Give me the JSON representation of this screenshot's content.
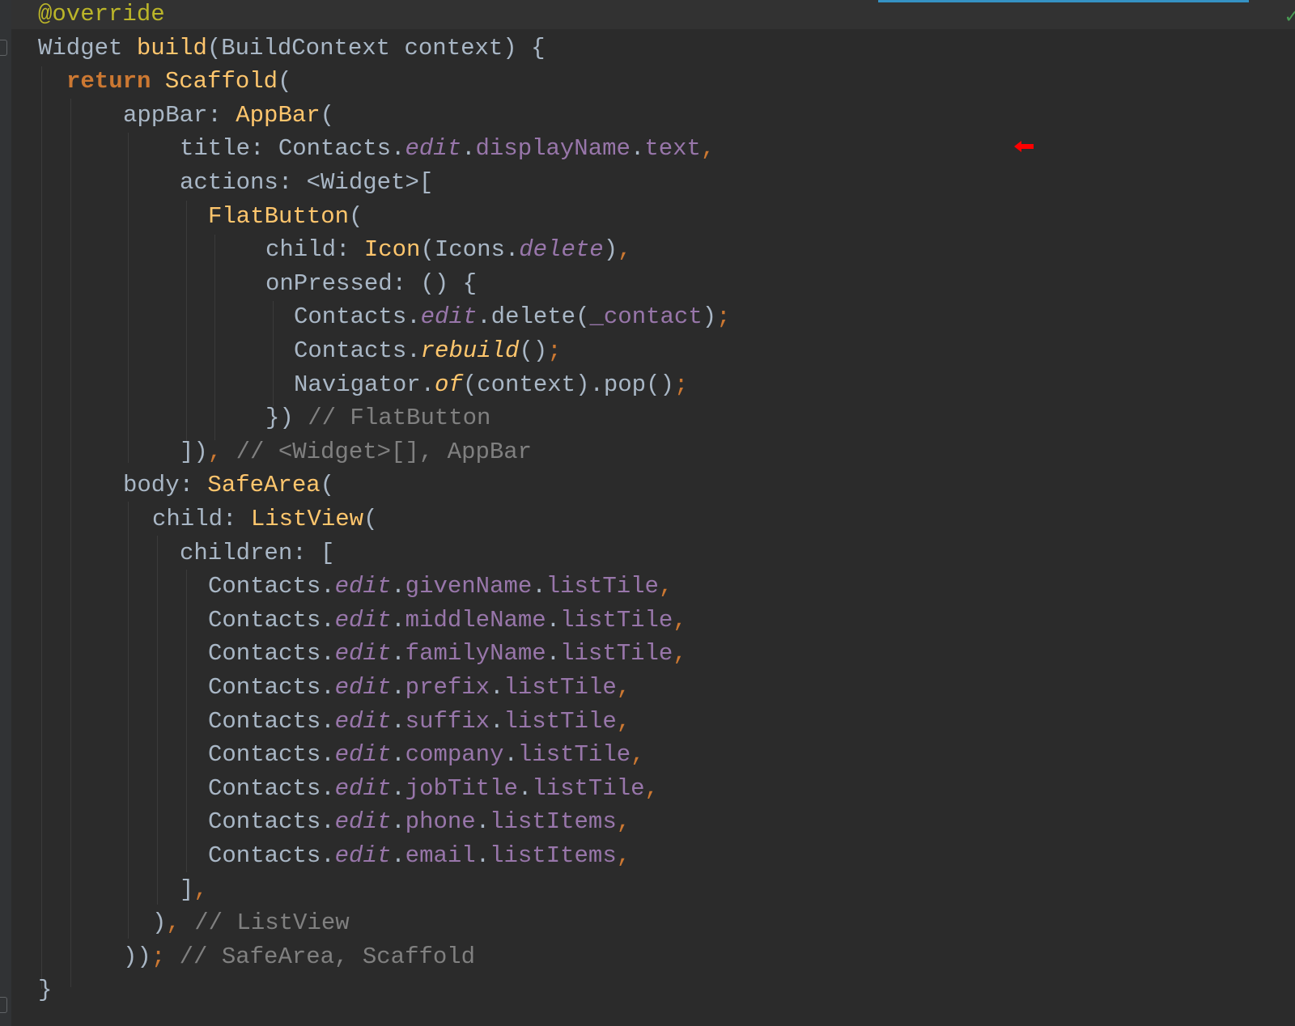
{
  "editor": {
    "theme_colors": {
      "background": "#2b2b2b",
      "default": "#a9b7c6",
      "keyword": "#cc7832",
      "class": "#ffc66d",
      "field": "#9876aa",
      "comment": "#808080",
      "annotation": "#bbb529",
      "marker": "#ff0000"
    },
    "marker_icon": "red-arrow-left-icon",
    "status_icon": "check-icon",
    "lines": [
      [
        {
          "t": "@override",
          "c": "ann"
        }
      ],
      [
        {
          "t": "Widget ",
          "c": ""
        },
        {
          "t": "build",
          "c": "cls"
        },
        {
          "t": "(BuildContext context) {",
          "c": ""
        }
      ],
      [
        {
          "t": "return ",
          "c": "kw"
        },
        {
          "t": "Scaffold",
          "c": "cls"
        },
        {
          "t": "(",
          "c": ""
        }
      ],
      [
        {
          "t": "appBar: ",
          "c": ""
        },
        {
          "t": "AppBar",
          "c": "cls"
        },
        {
          "t": "(",
          "c": ""
        }
      ],
      [
        {
          "t": "title: Contacts.",
          "c": ""
        },
        {
          "t": "edit",
          "c": "ital"
        },
        {
          "t": ".",
          "c": ""
        },
        {
          "t": "displayName",
          "c": "fld"
        },
        {
          "t": ".",
          "c": ""
        },
        {
          "t": "text",
          "c": "fld"
        },
        {
          "t": ",",
          "c": "pun"
        }
      ],
      [
        {
          "t": "actions: <Widget>[",
          "c": ""
        }
      ],
      [
        {
          "t": "FlatButton",
          "c": "cls"
        },
        {
          "t": "(",
          "c": ""
        }
      ],
      [
        {
          "t": "child: ",
          "c": ""
        },
        {
          "t": "Icon",
          "c": "cls"
        },
        {
          "t": "(Icons.",
          "c": ""
        },
        {
          "t": "delete",
          "c": "ital"
        },
        {
          "t": ")",
          "c": ""
        },
        {
          "t": ",",
          "c": "pun"
        }
      ],
      [
        {
          "t": "onPressed: () {",
          "c": ""
        }
      ],
      [
        {
          "t": "Contacts.",
          "c": ""
        },
        {
          "t": "edit",
          "c": "ital"
        },
        {
          "t": ".delete(",
          "c": ""
        },
        {
          "t": "_contact",
          "c": "fld"
        },
        {
          "t": ")",
          "c": ""
        },
        {
          "t": ";",
          "c": "pun"
        }
      ],
      [
        {
          "t": "Contacts.",
          "c": ""
        },
        {
          "t": "rebuild",
          "c": "ifn"
        },
        {
          "t": "()",
          "c": ""
        },
        {
          "t": ";",
          "c": "pun"
        }
      ],
      [
        {
          "t": "Navigator.",
          "c": ""
        },
        {
          "t": "of",
          "c": "ifn"
        },
        {
          "t": "(context).pop()",
          "c": ""
        },
        {
          "t": ";",
          "c": "pun"
        }
      ],
      [
        {
          "t": "}) ",
          "c": ""
        },
        {
          "t": "// FlatButton",
          "c": "cmt"
        }
      ],
      [
        {
          "t": "])",
          "c": ""
        },
        {
          "t": ",",
          "c": "pun"
        },
        {
          "t": " // <Widget>[], AppBar",
          "c": "cmt"
        }
      ],
      [
        {
          "t": "body: ",
          "c": ""
        },
        {
          "t": "SafeArea",
          "c": "cls"
        },
        {
          "t": "(",
          "c": ""
        }
      ],
      [
        {
          "t": "child: ",
          "c": ""
        },
        {
          "t": "ListView",
          "c": "cls"
        },
        {
          "t": "(",
          "c": ""
        }
      ],
      [
        {
          "t": "children: [",
          "c": ""
        }
      ],
      [
        {
          "t": "Contacts.",
          "c": ""
        },
        {
          "t": "edit",
          "c": "ital"
        },
        {
          "t": ".",
          "c": ""
        },
        {
          "t": "givenName",
          "c": "fld"
        },
        {
          "t": ".",
          "c": ""
        },
        {
          "t": "listTile",
          "c": "fld"
        },
        {
          "t": ",",
          "c": "pun"
        }
      ],
      [
        {
          "t": "Contacts.",
          "c": ""
        },
        {
          "t": "edit",
          "c": "ital"
        },
        {
          "t": ".",
          "c": ""
        },
        {
          "t": "middleName",
          "c": "fld"
        },
        {
          "t": ".",
          "c": ""
        },
        {
          "t": "listTile",
          "c": "fld"
        },
        {
          "t": ",",
          "c": "pun"
        }
      ],
      [
        {
          "t": "Contacts.",
          "c": ""
        },
        {
          "t": "edit",
          "c": "ital"
        },
        {
          "t": ".",
          "c": ""
        },
        {
          "t": "familyName",
          "c": "fld"
        },
        {
          "t": ".",
          "c": ""
        },
        {
          "t": "listTile",
          "c": "fld"
        },
        {
          "t": ",",
          "c": "pun"
        }
      ],
      [
        {
          "t": "Contacts.",
          "c": ""
        },
        {
          "t": "edit",
          "c": "ital"
        },
        {
          "t": ".",
          "c": ""
        },
        {
          "t": "prefix",
          "c": "fld"
        },
        {
          "t": ".",
          "c": ""
        },
        {
          "t": "listTile",
          "c": "fld"
        },
        {
          "t": ",",
          "c": "pun"
        }
      ],
      [
        {
          "t": "Contacts.",
          "c": ""
        },
        {
          "t": "edit",
          "c": "ital"
        },
        {
          "t": ".",
          "c": ""
        },
        {
          "t": "suffix",
          "c": "fld"
        },
        {
          "t": ".",
          "c": ""
        },
        {
          "t": "listTile",
          "c": "fld"
        },
        {
          "t": ",",
          "c": "pun"
        }
      ],
      [
        {
          "t": "Contacts.",
          "c": ""
        },
        {
          "t": "edit",
          "c": "ital"
        },
        {
          "t": ".",
          "c": ""
        },
        {
          "t": "company",
          "c": "fld"
        },
        {
          "t": ".",
          "c": ""
        },
        {
          "t": "listTile",
          "c": "fld"
        },
        {
          "t": ",",
          "c": "pun"
        }
      ],
      [
        {
          "t": "Contacts.",
          "c": ""
        },
        {
          "t": "edit",
          "c": "ital"
        },
        {
          "t": ".",
          "c": ""
        },
        {
          "t": "jobTitle",
          "c": "fld"
        },
        {
          "t": ".",
          "c": ""
        },
        {
          "t": "listTile",
          "c": "fld"
        },
        {
          "t": ",",
          "c": "pun"
        }
      ],
      [
        {
          "t": "Contacts.",
          "c": ""
        },
        {
          "t": "edit",
          "c": "ital"
        },
        {
          "t": ".",
          "c": ""
        },
        {
          "t": "phone",
          "c": "fld"
        },
        {
          "t": ".",
          "c": ""
        },
        {
          "t": "listItems",
          "c": "fld"
        },
        {
          "t": ",",
          "c": "pun"
        }
      ],
      [
        {
          "t": "Contacts.",
          "c": ""
        },
        {
          "t": "edit",
          "c": "ital"
        },
        {
          "t": ".",
          "c": ""
        },
        {
          "t": "email",
          "c": "fld"
        },
        {
          "t": ".",
          "c": ""
        },
        {
          "t": "listItems",
          "c": "fld"
        },
        {
          "t": ",",
          "c": "pun"
        }
      ],
      [
        {
          "t": "]",
          "c": ""
        },
        {
          "t": ",",
          "c": "pun"
        }
      ],
      [
        {
          "t": ")",
          "c": ""
        },
        {
          "t": ",",
          "c": "pun"
        },
        {
          "t": " // ListView",
          "c": "cmt"
        }
      ],
      [
        {
          "t": "))",
          "c": ""
        },
        {
          "t": ";",
          "c": "pun"
        },
        {
          "t": " // SafeArea, Scaffold",
          "c": "cmt"
        }
      ],
      [
        {
          "t": "}",
          "c": ""
        }
      ]
    ]
  }
}
